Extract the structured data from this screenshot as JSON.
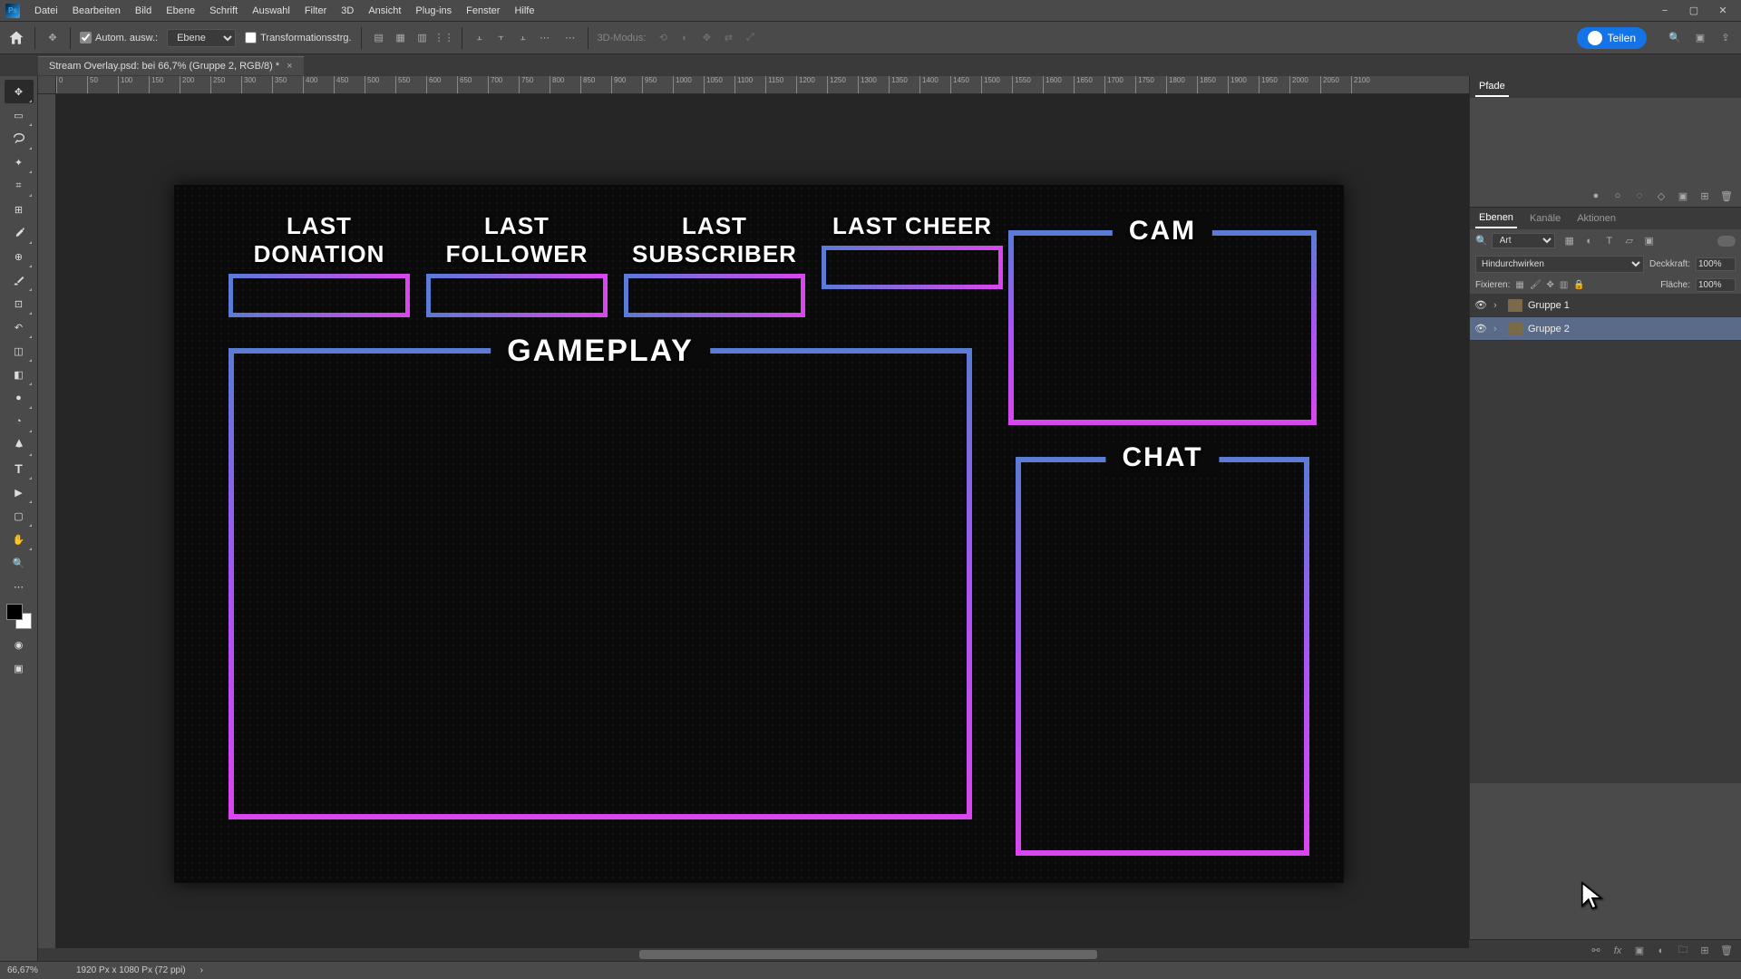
{
  "menu": [
    "Datei",
    "Bearbeiten",
    "Bild",
    "Ebene",
    "Schrift",
    "Auswahl",
    "Filter",
    "3D",
    "Ansicht",
    "Plug-ins",
    "Fenster",
    "Hilfe"
  ],
  "opt": {
    "auto_select": "Autom. ausw.:",
    "layer_type": "Ebene",
    "transform_ctrl": "Transformationsstrg.",
    "mode3d": "3D-Modus:"
  },
  "teilen": "Teilen",
  "doc_tab": "Stream Overlay.psd: bei 66,7% (Gruppe 2, RGB/8) *",
  "ruler_marks": [
    "0",
    "50",
    "100",
    "150",
    "200",
    "250",
    "300",
    "350",
    "400",
    "450",
    "500",
    "550",
    "600",
    "650",
    "700",
    "750",
    "800",
    "850",
    "900",
    "950",
    "1000",
    "1050",
    "1100",
    "1150",
    "1200",
    "1250",
    "1300",
    "1350",
    "1400",
    "1450",
    "1500",
    "1550",
    "1600",
    "1650",
    "1700",
    "1750",
    "1800",
    "1850",
    "1900",
    "1950",
    "2000",
    "2050",
    "2100"
  ],
  "overlay": {
    "last_donation": "LAST DONATION",
    "last_follower": "LAST FOLLOWER",
    "last_subscriber": "LAST SUBSCRIBER",
    "last_cheer": "LAST CHEER",
    "gameplay": "GAMEPLAY",
    "cam": "CAM",
    "chat": "CHAT"
  },
  "panels": {
    "pfade": "Pfade",
    "ebenen": "Ebenen",
    "kanaele": "Kanäle",
    "aktionen": "Aktionen",
    "search_kind": "Art",
    "blend_mode": "Hindurchwirken",
    "deckkraft_label": "Deckkraft:",
    "deckkraft_val": "100%",
    "fixieren": "Fixieren:",
    "flaeche_label": "Fläche:",
    "flaeche_val": "100%",
    "layers": [
      {
        "name": "Gruppe 1",
        "selected": false
      },
      {
        "name": "Gruppe 2",
        "selected": true
      }
    ]
  },
  "status": {
    "zoom": "66,67%",
    "docinfo": "1920 Px x 1080 Px (72 ppi)"
  }
}
